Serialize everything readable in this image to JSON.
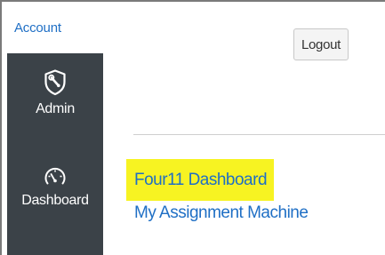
{
  "header": {
    "account_link": "Account",
    "logout_label": "Logout"
  },
  "sidebar": {
    "items": [
      {
        "label": "Admin",
        "icon": "shield-wrench-icon"
      },
      {
        "label": "Dashboard",
        "icon": "gauge-icon"
      }
    ]
  },
  "main": {
    "links": [
      {
        "label": "Four11 Dashboard",
        "highlighted": true
      },
      {
        "label": "My Assignment Machine",
        "highlighted": false
      }
    ]
  },
  "colors": {
    "sidebar_bg": "#3b4248",
    "link": "#1f6fc5",
    "highlight": "#f7f322"
  }
}
